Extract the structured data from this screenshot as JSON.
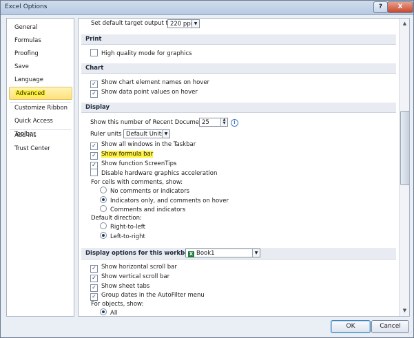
{
  "window": {
    "title": "Excel Options",
    "help": "?",
    "close": "X"
  },
  "sidebar": {
    "items": [
      {
        "label": "General"
      },
      {
        "label": "Formulas"
      },
      {
        "label": "Proofing"
      },
      {
        "label": "Save"
      },
      {
        "label": "Language"
      },
      {
        "label": "Advanced"
      },
      {
        "label": "Customize Ribbon"
      },
      {
        "label": "Quick Access Toolbar"
      },
      {
        "label": "Add-Ins"
      },
      {
        "label": "Trust Center"
      }
    ]
  },
  "top_row": {
    "label": "Set default target output to:",
    "value": "220 ppi"
  },
  "print": {
    "header": "Print",
    "high_quality": "High quality mode for graphics"
  },
  "chart": {
    "header": "Chart",
    "names": "Show chart element names on hover",
    "values": "Show data point values on hover"
  },
  "display": {
    "header": "Display",
    "recent_label": "Show this number of Recent Documents:",
    "recent_value": "25",
    "info": "i",
    "ruler_label": "Ruler units",
    "ruler_value": "Default Units",
    "all_windows": "Show all windows in the Taskbar",
    "formula_bar": "Show formula bar",
    "screentips": "Show function ScreenTips",
    "hw_accel": "Disable hardware graphics acceleration",
    "comments_label": "For cells with comments, show:",
    "no_comments": "No comments or indicators",
    "indicators_only": "Indicators only, and comments on hover",
    "comments_and_indicators": "Comments and indicators",
    "direction_label": "Default direction:",
    "rtl": "Right-to-left",
    "ltr": "Left-to-right"
  },
  "workbook": {
    "header": "Display options for this workbook:",
    "book_icon": "X",
    "book": "Book1",
    "h_scroll": "Show horizontal scroll bar",
    "v_scroll": "Show vertical scroll bar",
    "sheet_tabs": "Show sheet tabs",
    "group_dates": "Group dates in the AutoFilter menu",
    "objects_label": "For objects, show:",
    "all": "All"
  },
  "buttons": {
    "ok": "OK",
    "cancel": "Cancel"
  },
  "icons": {
    "check": "✓",
    "down": "▼",
    "up": "▲"
  },
  "colors": {
    "highlight": "#fff23a",
    "selected_nav": "#ffe17a"
  }
}
